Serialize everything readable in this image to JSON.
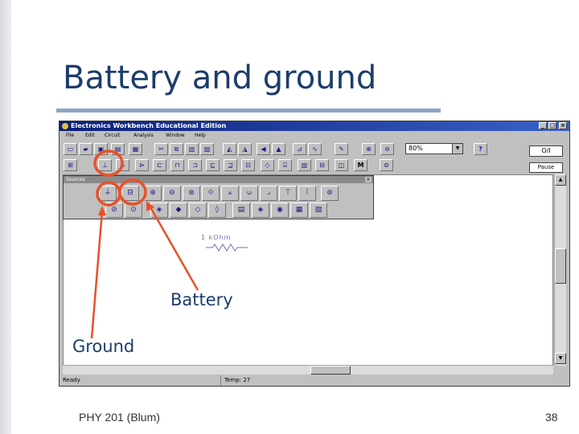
{
  "slide": {
    "title": "Battery and ground",
    "footer_left": "PHY 201 (Blum)",
    "page_number": "38"
  },
  "app": {
    "title": "Electronics Workbench Educational Edition",
    "window_buttons": {
      "minimize": "_",
      "maximize": "□",
      "close": "×"
    },
    "menu": [
      "File",
      "Edit",
      "Circuit",
      "Analysis",
      "Window",
      "Help"
    ],
    "zoom": "80%",
    "help_label": "?",
    "power_label": "O/I",
    "pause_label": "Pause",
    "palette_title": "Sources",
    "resistor_label": "1 kOhm",
    "status": {
      "ready": "Ready",
      "temp": "Temp: 27"
    }
  },
  "annotations": {
    "battery": "Battery",
    "ground": "Ground"
  },
  "colors": {
    "highlight": "#e8502a",
    "title": "#1c3d6b",
    "titlebar": "#0a1e78"
  }
}
